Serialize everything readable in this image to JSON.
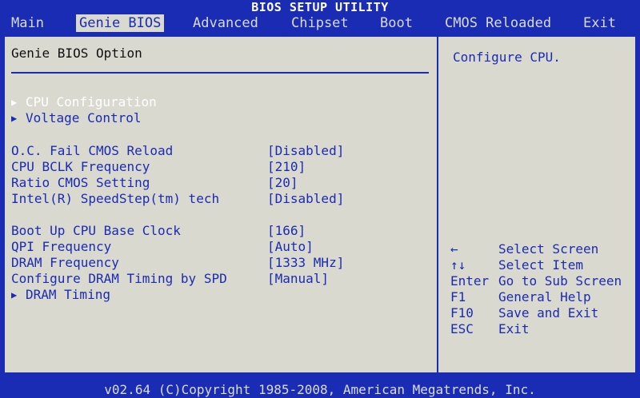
{
  "title": "BIOS SETUP UTILITY",
  "menu": [
    "Main",
    "Genie BIOS",
    "Advanced",
    "Chipset",
    "Boot",
    "CMOS Reloaded",
    "Exit"
  ],
  "active_menu": "Genie BIOS",
  "section_title": "Genie BIOS Option",
  "submenus": {
    "cpu_config": "CPU Configuration",
    "voltage": "Voltage Control",
    "dram_timing": "DRAM Timing"
  },
  "settings": [
    {
      "label": "O.C. Fail CMOS Reload",
      "value": "[Disabled]"
    },
    {
      "label": "CPU BCLK Frequency",
      "value": "[210]"
    },
    {
      "label": "Ratio CMOS Setting",
      "value": "[20]"
    },
    {
      "label": "Intel(R) SpeedStep(tm) tech",
      "value": "[Disabled]"
    },
    {
      "label": "Boot Up CPU Base Clock",
      "value": "[166]"
    },
    {
      "label": "QPI Frequency",
      "value": "[Auto]"
    },
    {
      "label": "DRAM Frequency",
      "value": "[1333 MHz]"
    },
    {
      "label": "Configure DRAM Timing by SPD",
      "value": "[Manual]"
    }
  ],
  "help": "Configure CPU.",
  "keys": [
    {
      "key": "←",
      "desc": "Select Screen"
    },
    {
      "key": "↑↓",
      "desc": "Select Item"
    },
    {
      "key": "Enter",
      "desc": "Go to Sub Screen"
    },
    {
      "key": "F1",
      "desc": "General Help"
    },
    {
      "key": "F10",
      "desc": "Save and Exit"
    },
    {
      "key": "ESC",
      "desc": "Exit"
    }
  ],
  "footer": "v02.64 (C)Copyright 1985-2008, American Megatrends, Inc.",
  "colors": {
    "background": "#1a2bb4",
    "panel": "#d9d9d0",
    "text": "#1a2bb4",
    "highlight": "#ffffff"
  }
}
